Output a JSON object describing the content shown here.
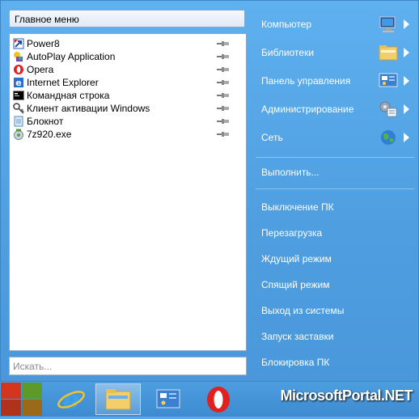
{
  "menu": {
    "header_title": "Главное меню",
    "programs": [
      {
        "label": "Power8",
        "icon": "power8-icon"
      },
      {
        "label": "AutoPlay Application",
        "icon": "autoplay-icon"
      },
      {
        "label": "Opera",
        "icon": "opera-icon"
      },
      {
        "label": "Internet Explorer",
        "icon": "ie-icon"
      },
      {
        "label": "Командная строка",
        "icon": "cmd-icon"
      },
      {
        "label": "Клиент активации Windows",
        "icon": "activation-icon"
      },
      {
        "label": "Блокнот",
        "icon": "notepad-icon"
      },
      {
        "label": "7z920.exe",
        "icon": "installer-icon"
      }
    ],
    "search_placeholder": "Искать..."
  },
  "right": {
    "computer": "Компьютер",
    "libraries": "Библиотеки",
    "control_panel": "Панель управления",
    "administration": "Администрирование",
    "network": "Сеть",
    "run": "Выполнить...",
    "shutdown": "Выключение ПК",
    "restart": "Перезагрузка",
    "standby": "Ждущий режим",
    "sleep": "Спящий режим",
    "logoff": "Выход из системы",
    "screensaver": "Запуск заставки",
    "lock": "Блокировка ПК"
  },
  "brand": "MicrosoftPortal.NET",
  "colors": {
    "menu_bg": "#4e9ee0",
    "taskbar": "#3d8ad0",
    "accent_white": "#ffffff"
  }
}
